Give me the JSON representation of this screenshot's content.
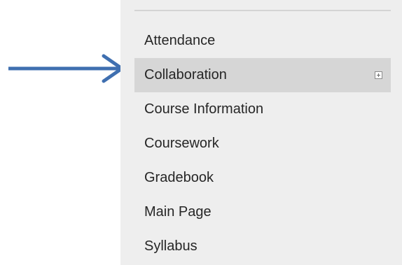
{
  "menu": {
    "items": [
      {
        "label": "Attendance"
      },
      {
        "label": "Collaboration",
        "selected": true,
        "expandable": true
      },
      {
        "label": "Course Information"
      },
      {
        "label": "Coursework"
      },
      {
        "label": "Gradebook"
      },
      {
        "label": "Main Page"
      },
      {
        "label": "Syllabus"
      }
    ]
  },
  "annotation": {
    "icon": "arrow-right-icon",
    "color": "#3f6fb0"
  },
  "colors": {
    "panel_background": "#eeeeee",
    "selected_background": "#d6d6d6",
    "text": "#262626"
  }
}
